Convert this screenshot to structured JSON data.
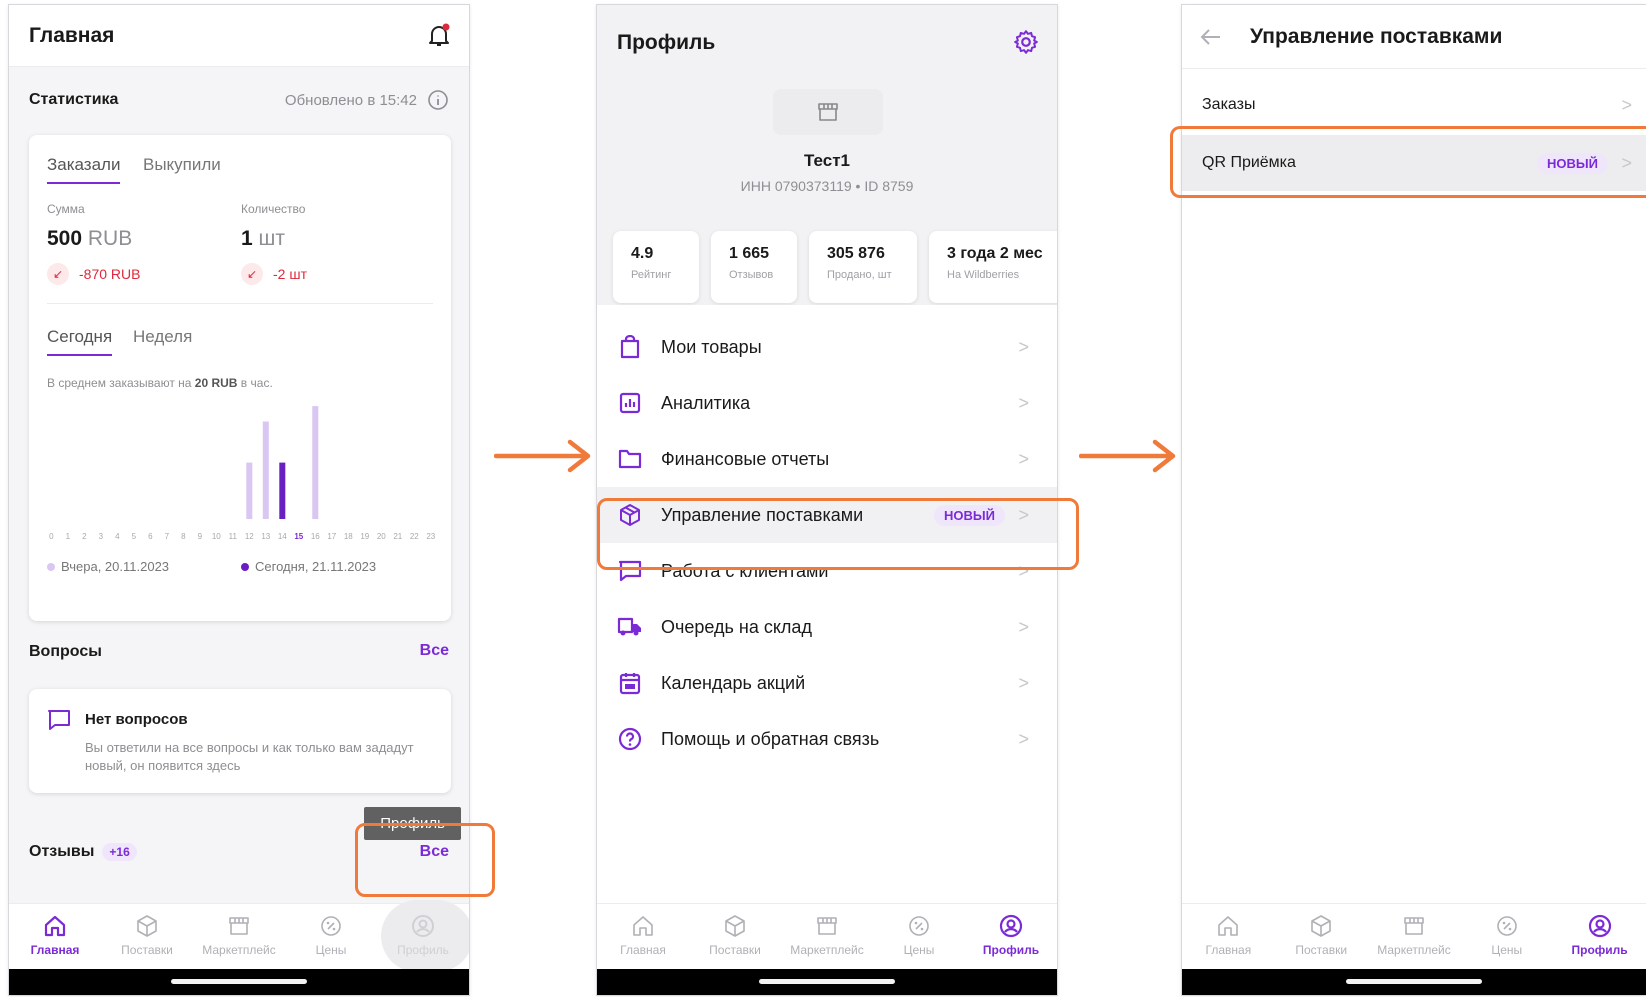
{
  "screen1": {
    "title": "Главная",
    "stats": {
      "heading": "Статистика",
      "updated": "Обновлено в 15:42",
      "tabs": [
        "Заказали",
        "Выкупили"
      ],
      "sum_label": "Сумма",
      "sum_value": "500",
      "sum_unit": "RUB",
      "sum_delta": "-870 RUB",
      "qty_label": "Количество",
      "qty_value": "1",
      "qty_unit": "шт",
      "qty_delta": "-2 шт",
      "period_tabs": [
        "Сегодня",
        "Неделя"
      ],
      "avg_prefix": "В среднем заказывают на ",
      "avg_value": "20 RUB",
      "avg_suffix": " в час.",
      "legend_yesterday": "Вчера, 20.11.2023",
      "legend_today": "Сегодня, 21.11.2023"
    },
    "chart_data": {
      "type": "bar",
      "categories": [
        "0",
        "1",
        "2",
        "3",
        "4",
        "5",
        "6",
        "7",
        "8",
        "9",
        "10",
        "11",
        "12",
        "13",
        "14",
        "15",
        "16",
        "17",
        "18",
        "19",
        "20",
        "21",
        "22",
        "23"
      ],
      "series": [
        {
          "name": "Вчера, 20.11.2023",
          "color": "#d9c6f3",
          "values": [
            0,
            0,
            0,
            0,
            0,
            0,
            0,
            0,
            0,
            0,
            0,
            0,
            0.55,
            0.95,
            0,
            0,
            1.1,
            0,
            0,
            0,
            0,
            0,
            0,
            0
          ]
        },
        {
          "name": "Сегодня, 21.11.2023",
          "color": "#6a1fc2",
          "values": [
            0,
            0,
            0,
            0,
            0,
            0,
            0,
            0,
            0,
            0,
            0,
            0,
            0,
            0,
            0.55,
            0,
            0,
            0,
            0,
            0,
            0,
            0,
            0,
            0
          ]
        }
      ],
      "highlight_tick": "15",
      "ylim": [
        0,
        1.15
      ],
      "grid": false,
      "legend": "bottom"
    },
    "questions": {
      "heading": "Вопросы",
      "all": "Все",
      "empty_title": "Нет вопросов",
      "empty_text": "Вы ответили на все вопросы и как только вам зададут новый, он появится здесь"
    },
    "reviews": {
      "heading": "Отзывы",
      "count": "+16",
      "all": "Все"
    },
    "tooltip": "Профиль"
  },
  "tabbar": [
    "Главная",
    "Поставки",
    "Маркетплейс",
    "Цены",
    "Профиль"
  ],
  "screen2": {
    "title": "Профиль",
    "seller_name": "Тест1",
    "seller_meta": "ИНН 0790373119 • ID 8759",
    "stats": [
      {
        "value": "4.9",
        "label": "Рейтинг"
      },
      {
        "value": "1 665",
        "label": "Отзывов"
      },
      {
        "value": "305 876",
        "label": "Продано, шт"
      },
      {
        "value": "3 года 2 мес",
        "label": "На Wildberries"
      }
    ],
    "menu": [
      {
        "label": "Мои товары",
        "icon": "bag-icon"
      },
      {
        "label": "Аналитика",
        "icon": "analytics-icon"
      },
      {
        "label": "Финансовые отчеты",
        "icon": "folder-icon"
      },
      {
        "label": "Управление поставками",
        "icon": "box-icon",
        "badge": "НОВЫЙ"
      },
      {
        "label": "Работа с клиентами",
        "icon": "chat-icon"
      },
      {
        "label": "Очередь на склад",
        "icon": "truck-icon"
      },
      {
        "label": "Календарь акций",
        "icon": "calendar-icon"
      },
      {
        "label": "Помощь и обратная связь",
        "icon": "help-icon"
      }
    ]
  },
  "screen3": {
    "title": "Управление поставками",
    "items": [
      {
        "label": "Заказы"
      },
      {
        "label": "QR Приёмка",
        "badge": "НОВЫЙ"
      }
    ]
  },
  "colors": {
    "accent": "#7b2bd6",
    "highlight": "#f07a3a",
    "negative": "#e0283c"
  }
}
